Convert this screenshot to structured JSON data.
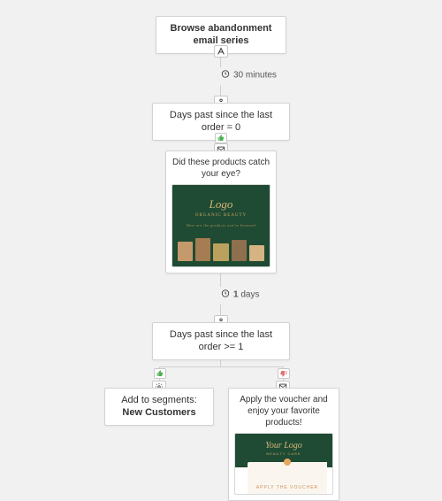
{
  "trigger": {
    "title": "Browse abandonment email series"
  },
  "delay1": {
    "text": "30 minutes"
  },
  "cond1": {
    "line1": "Days past since the last",
    "line2_prefix": "order",
    "line2_op": " = 0"
  },
  "email1": {
    "subject": "Did these products catch your eye?",
    "brand_top": "Logo",
    "brand_sub": "ORGANIC BEAUTY"
  },
  "delay2": {
    "value": "1",
    "unit": " days"
  },
  "cond2": {
    "line1": "Days past since the last",
    "line2_prefix": "order",
    "line2_op": " >= 1"
  },
  "branch_yes": {
    "action_prefix": "Add to segments: ",
    "action_value": "New Customers"
  },
  "branch_no": {
    "subject": "Apply the voucher and enjoy your favorite products!",
    "brand_top": "Your Logo",
    "brand_sub": "BEAUTY CARE",
    "cta": "APPLY THE VOUCHER"
  }
}
